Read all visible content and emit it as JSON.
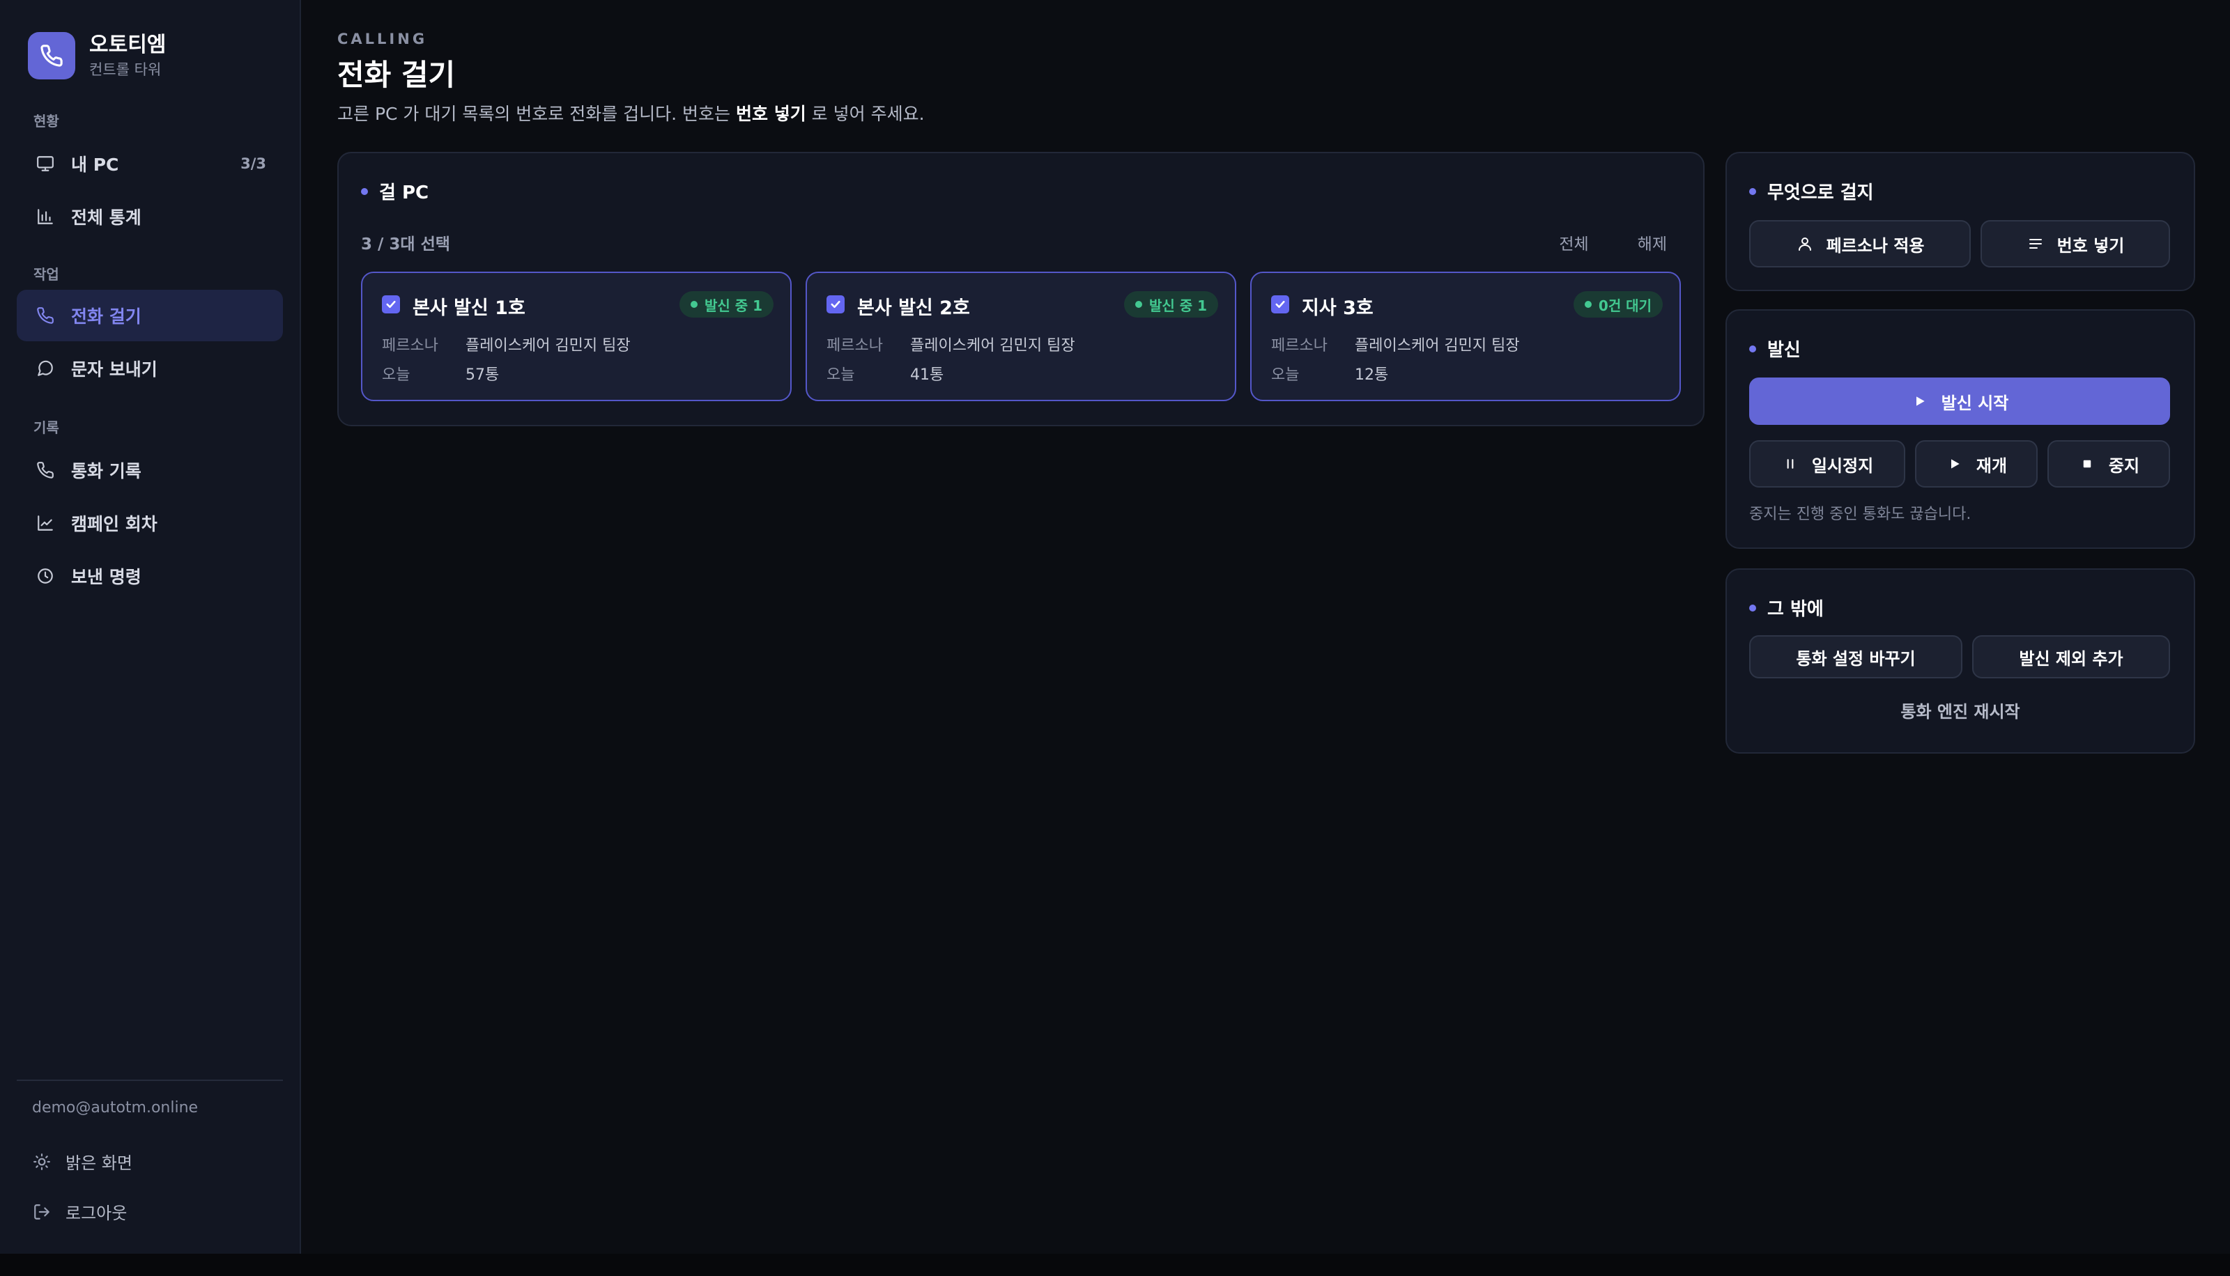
{
  "app": {
    "name": "오토티엠",
    "subtitle": "컨트롤 타워"
  },
  "sidebar": {
    "sections": [
      {
        "label": "현황"
      },
      {
        "label": "작업"
      },
      {
        "label": "기록"
      }
    ],
    "items": [
      {
        "label": "내 PC",
        "count": "3/3",
        "icon": "monitor-icon"
      },
      {
        "label": "전체 통계",
        "icon": "bar-chart-icon"
      },
      {
        "label": "전화 걸기",
        "icon": "phone-icon",
        "active": true
      },
      {
        "label": "문자 보내기",
        "icon": "message-icon"
      },
      {
        "label": "통화 기록",
        "icon": "phone-icon"
      },
      {
        "label": "캠페인 회차",
        "icon": "line-chart-icon"
      },
      {
        "label": "보낸 명령",
        "icon": "clock-icon"
      }
    ],
    "user_email": "demo@autotm.online",
    "footer": [
      {
        "label": "밝은 화면",
        "icon": "sun-icon"
      },
      {
        "label": "로그아웃",
        "icon": "logout-icon"
      }
    ]
  },
  "page": {
    "eyebrow": "CALLING",
    "title": "전화 걸기",
    "desc_before": "고른 PC 가 대기 목록의 번호로 전화를 겁니다. 번호는 ",
    "desc_bold": "번호 넣기",
    "desc_after": " 로 넣어 주세요."
  },
  "pc_panel": {
    "title": "걸 PC",
    "selection_count": "3 / 3대 선택",
    "select_all": "전체",
    "deselect": "해제",
    "persona_label": "페르소나",
    "today_label": "오늘",
    "cards": [
      {
        "name": "본사 발신 1호",
        "badge": "발신 중 1",
        "persona": "플레이스케어 김민지 팀장",
        "today": "57통"
      },
      {
        "name": "본사 발신 2호",
        "badge": "발신 중 1",
        "persona": "플레이스케어 김민지 팀장",
        "today": "41통"
      },
      {
        "name": "지사 3호",
        "badge": "0건 대기",
        "persona": "플레이스케어 김민지 팀장",
        "today": "12통"
      }
    ]
  },
  "what_panel": {
    "title": "무엇으로 걸지",
    "apply_persona": "페르소나 적용",
    "add_numbers": "번호 넣기"
  },
  "dial_panel": {
    "title": "발신",
    "start": "발신 시작",
    "pause": "일시정지",
    "resume": "재개",
    "stop": "중지",
    "note": "중지는 진행 중인 통화도 끊습니다."
  },
  "other_panel": {
    "title": "그 밖에",
    "change_settings": "통화 설정 바꾸기",
    "add_exclusion": "발신 제외 추가",
    "restart_engine": "통화 엔진 재시작"
  },
  "colors": {
    "accent": "#6366d6",
    "success": "#43c991",
    "background": "#0b0d12",
    "panel": "#121622"
  }
}
